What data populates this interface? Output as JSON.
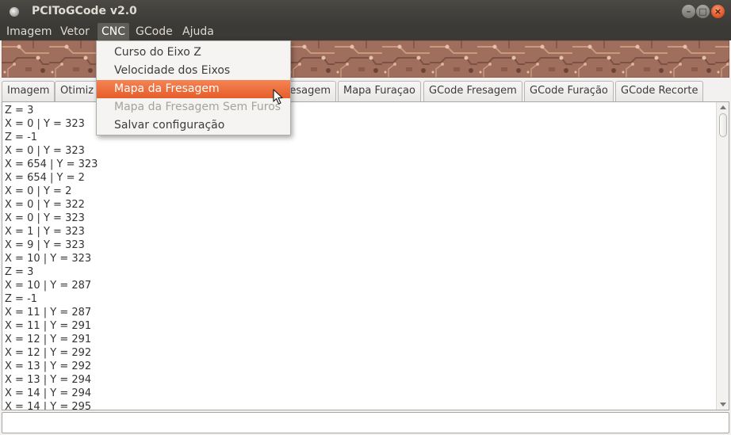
{
  "window": {
    "title": "PCIToGCode  v2.0"
  },
  "menubar": {
    "items": [
      {
        "label": "Imagem"
      },
      {
        "label": "Vetor"
      },
      {
        "label": "CNC"
      },
      {
        "label": "GCode"
      },
      {
        "label": "Ajuda"
      }
    ],
    "active": "CNC"
  },
  "cnc_menu": {
    "items": [
      {
        "label": "Curso do Eixo Z",
        "state": "normal"
      },
      {
        "label": "Velocidade dos Eixos",
        "state": "normal"
      },
      {
        "label": "Mapa da Fresagem",
        "state": "highlighted"
      },
      {
        "label": "Mapa da Fresagem Sem Furos",
        "state": "disabled"
      },
      {
        "label": "Salvar configuração",
        "state": "normal"
      }
    ]
  },
  "tabs": [
    {
      "label": "Imagem"
    },
    {
      "label": "Otimiz"
    },
    {
      "label": "resagem"
    },
    {
      "label": "Mapa Furaçao"
    },
    {
      "label": "GCode Fresagem"
    },
    {
      "label": "GCode Furação"
    },
    {
      "label": "GCode Recorte"
    }
  ],
  "output_lines": [
    "Z = 3",
    "X = 0 | Y = 323",
    "Z = -1",
    "X = 0 | Y = 323",
    "X = 654 | Y = 323",
    "X = 654 | Y = 2",
    "X = 0 | Y = 2",
    "X = 0 | Y = 322",
    "X = 0 | Y = 323",
    "X = 1 | Y = 323",
    "X = 9 | Y = 323",
    "X = 10 | Y = 323",
    "Z = 3",
    "X = 10 | Y = 287",
    "Z = -1",
    "X = 11 | Y = 287",
    "X = 11 | Y = 291",
    "X = 12 | Y = 291",
    "X = 12 | Y = 292",
    "X = 13 | Y = 292",
    "X = 13 | Y = 294",
    "X = 14 | Y = 294",
    "X = 14 | Y = 295"
  ],
  "colors": {
    "highlight": "#e55d2a",
    "titlebar": "#3c3b37",
    "close_button": "#e0582a"
  },
  "icons": {
    "app": "app-icon",
    "minimize": "minimize-icon",
    "maximize": "maximize-icon",
    "close": "close-icon",
    "cursor": "mouse-pointer-icon"
  }
}
